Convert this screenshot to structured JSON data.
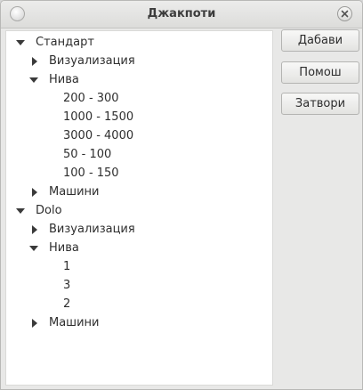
{
  "window": {
    "title": "Джакпоти"
  },
  "buttons": {
    "add": "Дабави",
    "help": "Помош",
    "close": "Затвори"
  },
  "tree": {
    "standard": {
      "label": "Стандарт",
      "visualization": "Визуализация",
      "levels": {
        "label": "Нива",
        "items": [
          "200 - 300",
          "1000 - 1500",
          "3000 - 4000",
          "50 - 100",
          "100 - 150"
        ]
      },
      "machines": "Машини"
    },
    "dolo": {
      "label": "Dolo",
      "visualization": "Визуализация",
      "levels": {
        "label": "Нива",
        "items": [
          "1",
          "3",
          "2"
        ]
      },
      "machines": "Машини"
    }
  },
  "icons": {
    "expanded": "triangle-down-icon",
    "collapsed": "triangle-right-icon",
    "close": "close-icon"
  }
}
